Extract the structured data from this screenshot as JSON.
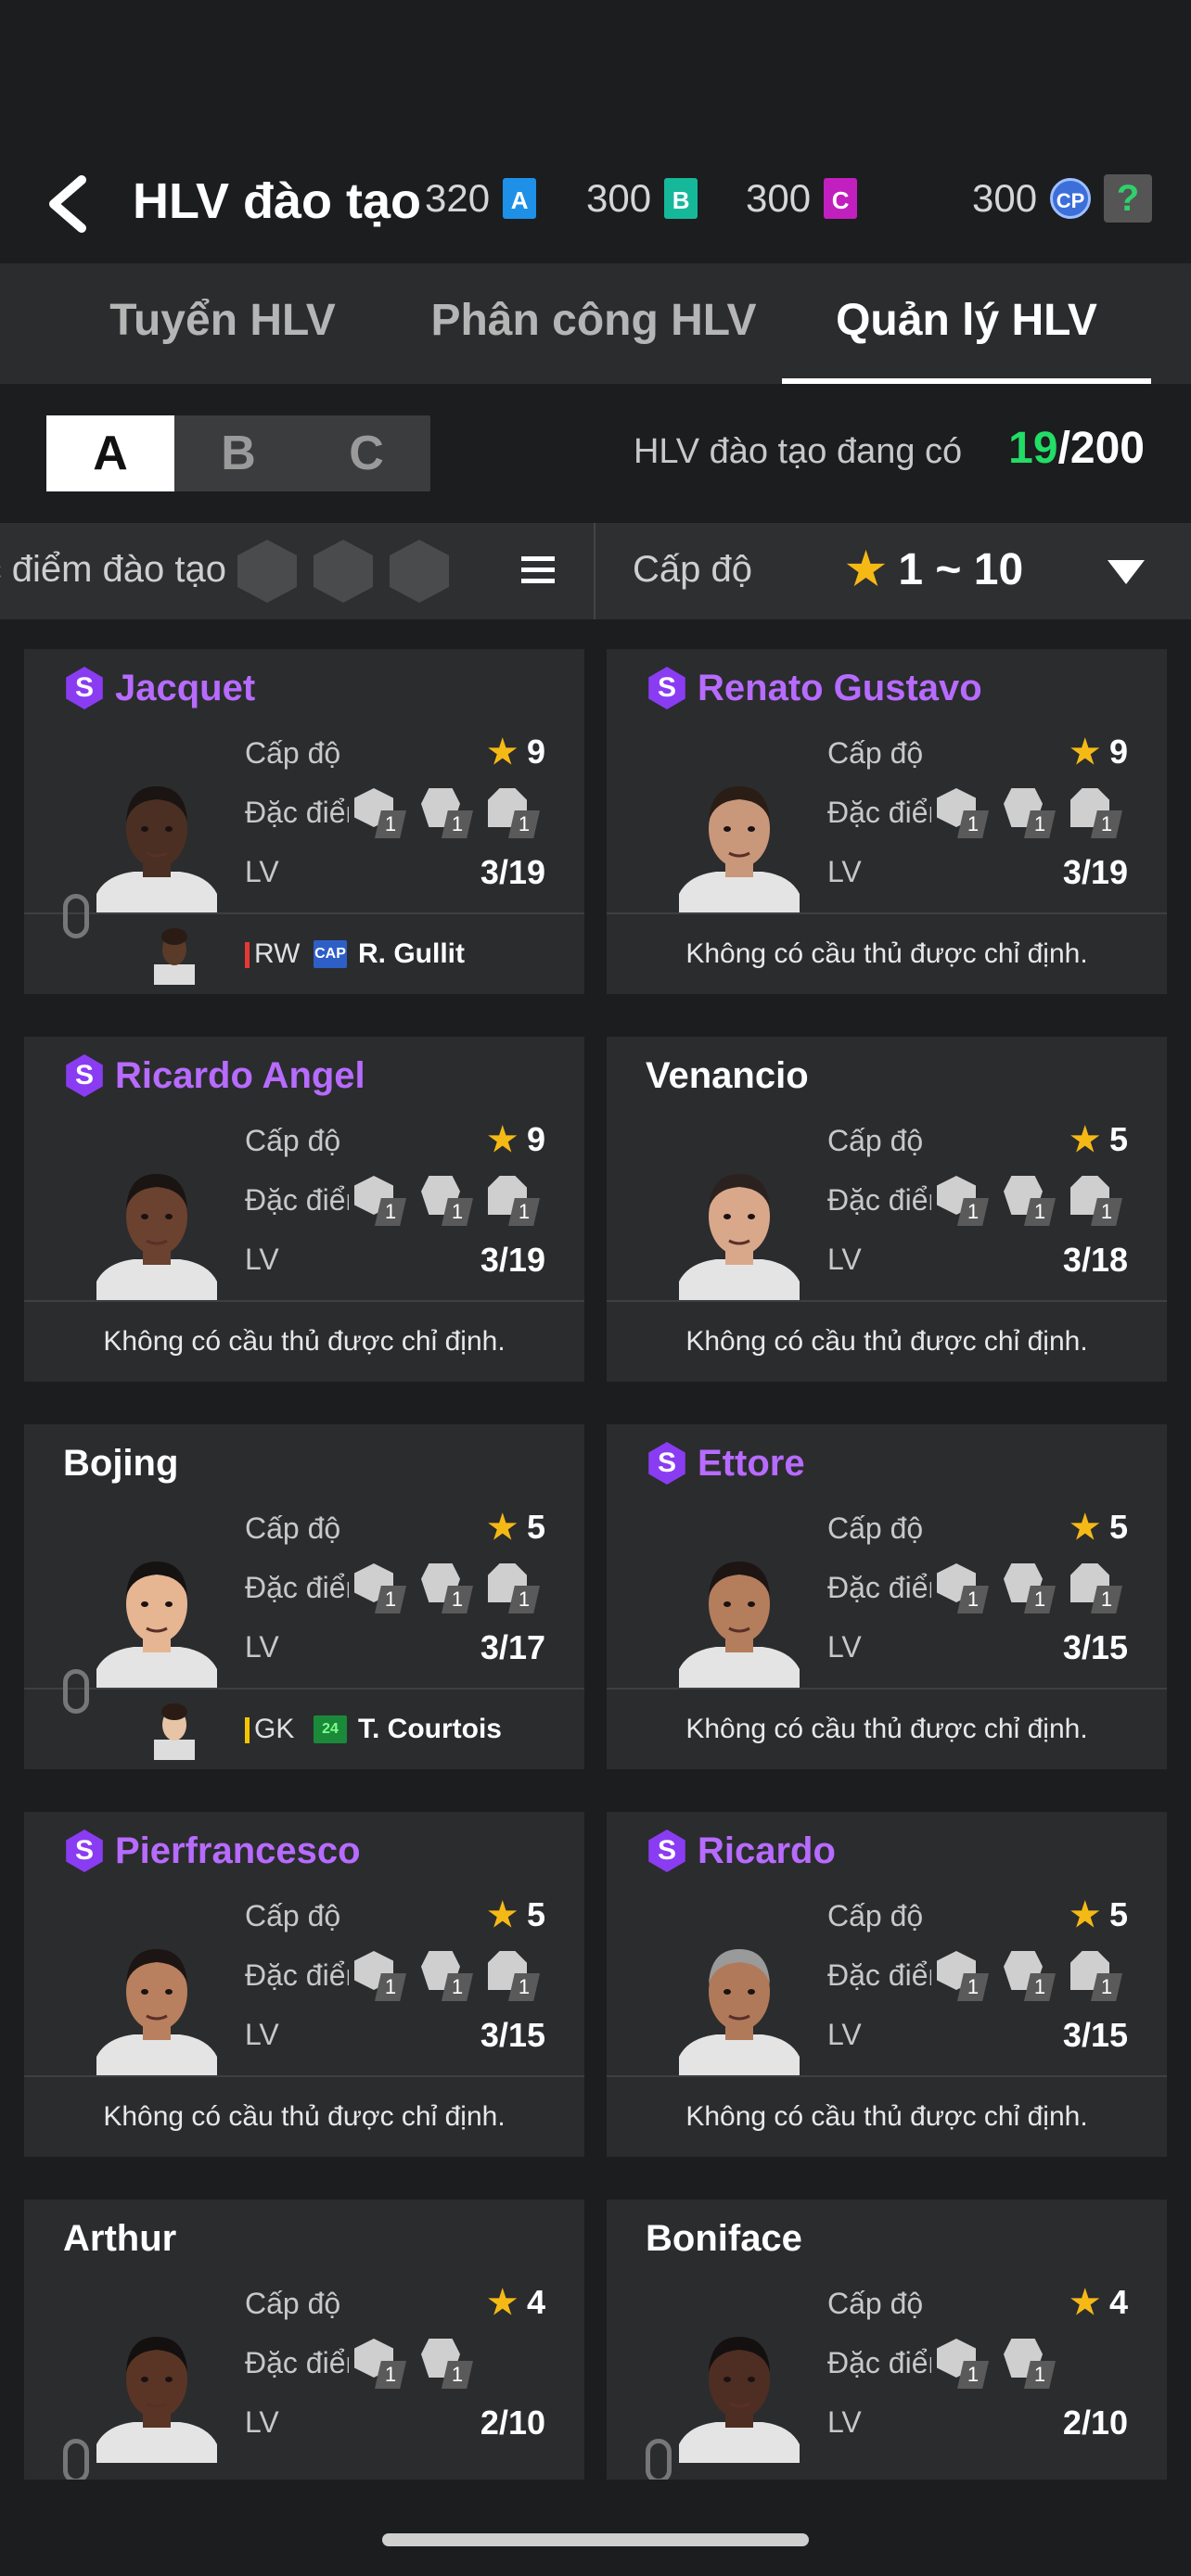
{
  "header": {
    "title": "HLV đào tạo",
    "currencies": [
      {
        "amount": "320",
        "token": "A",
        "color": "#1e90e8"
      },
      {
        "amount": "300",
        "token": "B",
        "color": "#16b89a"
      },
      {
        "amount": "300",
        "token": "C",
        "color": "#c21fbf"
      },
      {
        "amount": "300",
        "token": "CP",
        "color": "#3d6fd9"
      }
    ],
    "help": "?"
  },
  "tabs": [
    {
      "label": "Tuyển HLV",
      "active": false
    },
    {
      "label": "Phân công  HLV",
      "active": false
    },
    {
      "label": "Quản lý HLV",
      "active": true
    }
  ],
  "segments": [
    {
      "label": "A",
      "active": true
    },
    {
      "label": "B",
      "active": false
    },
    {
      "label": "C",
      "active": false
    }
  ],
  "count": {
    "label": "HLV đào tạo đang có",
    "current": "19",
    "separator": "/",
    "max": "200"
  },
  "filter": {
    "trait_label": "Đặc điểm đào tạo",
    "level_label": "Cấp độ",
    "level_star": "★",
    "level_range": "1 ~ 10"
  },
  "row_labels": {
    "level": "Cấp độ",
    "traits": "Đặc điểm",
    "lv": "LV"
  },
  "no_player": "Không có cầu thủ được chỉ định.",
  "coaches": [
    {
      "name": "Jacquet",
      "special": true,
      "level": "9",
      "lv": "3/19",
      "traits": [
        "1",
        "1",
        "1"
      ],
      "skin": "#4a2f22",
      "hair": "#1a1412",
      "assigned": {
        "position": "RW",
        "pos_color": "#e53935",
        "badge": "CAP",
        "badge_color": "#2d5fc7",
        "player": "R. Gullit"
      }
    },
    {
      "name": "Renato Gustavo",
      "special": true,
      "level": "9",
      "lv": "3/19",
      "traits": [
        "1",
        "1",
        "1"
      ],
      "skin": "#c9977a",
      "hair": "#2a1d16",
      "assigned": null
    },
    {
      "name": "Ricardo Angel",
      "special": true,
      "level": "9",
      "lv": "3/19",
      "traits": [
        "1",
        "1",
        "1"
      ],
      "skin": "#6b4130",
      "hair": "#1a1412",
      "assigned": null
    },
    {
      "name": "Venancio",
      "special": false,
      "level": "5",
      "lv": "3/18",
      "traits": [
        "1",
        "1",
        "1"
      ],
      "skin": "#d9a88a",
      "hair": "#2b2220",
      "assigned": null
    },
    {
      "name": "Bojing",
      "special": false,
      "level": "5",
      "lv": "3/17",
      "traits": [
        "1",
        "1",
        "1"
      ],
      "skin": "#e6b592",
      "hair": "#151212",
      "assigned": {
        "position": "GK",
        "pos_color": "#f5c400",
        "badge": "24",
        "badge_color": "#1a8a3a",
        "player": "T. Courtois"
      }
    },
    {
      "name": "Ettore",
      "special": true,
      "level": "5",
      "lv": "3/15",
      "traits": [
        "1",
        "1",
        "1"
      ],
      "skin": "#b47d5c",
      "hair": "#1c1513",
      "assigned": null
    },
    {
      "name": "Pierfrancesco",
      "special": true,
      "level": "5",
      "lv": "3/15",
      "traits": [
        "1",
        "1",
        "1"
      ],
      "skin": "#b8805e",
      "hair": "#1c1513",
      "assigned": null
    },
    {
      "name": "Ricardo",
      "special": true,
      "level": "5",
      "lv": "3/15",
      "traits": [
        "1",
        "1",
        "1"
      ],
      "skin": "#b07a5a",
      "hair": "#9a9a9a",
      "assigned": null
    },
    {
      "name": "Arthur",
      "special": false,
      "level": "4",
      "lv": "2/10",
      "traits": [
        "1",
        "1"
      ],
      "skin": "#5a3526",
      "hair": "#141010",
      "assigned": null
    },
    {
      "name": "Boniface",
      "special": false,
      "level": "4",
      "lv": "2/10",
      "traits": [
        "1",
        "1"
      ],
      "skin": "#4e2e22",
      "hair": "#141010",
      "assigned": null
    }
  ]
}
